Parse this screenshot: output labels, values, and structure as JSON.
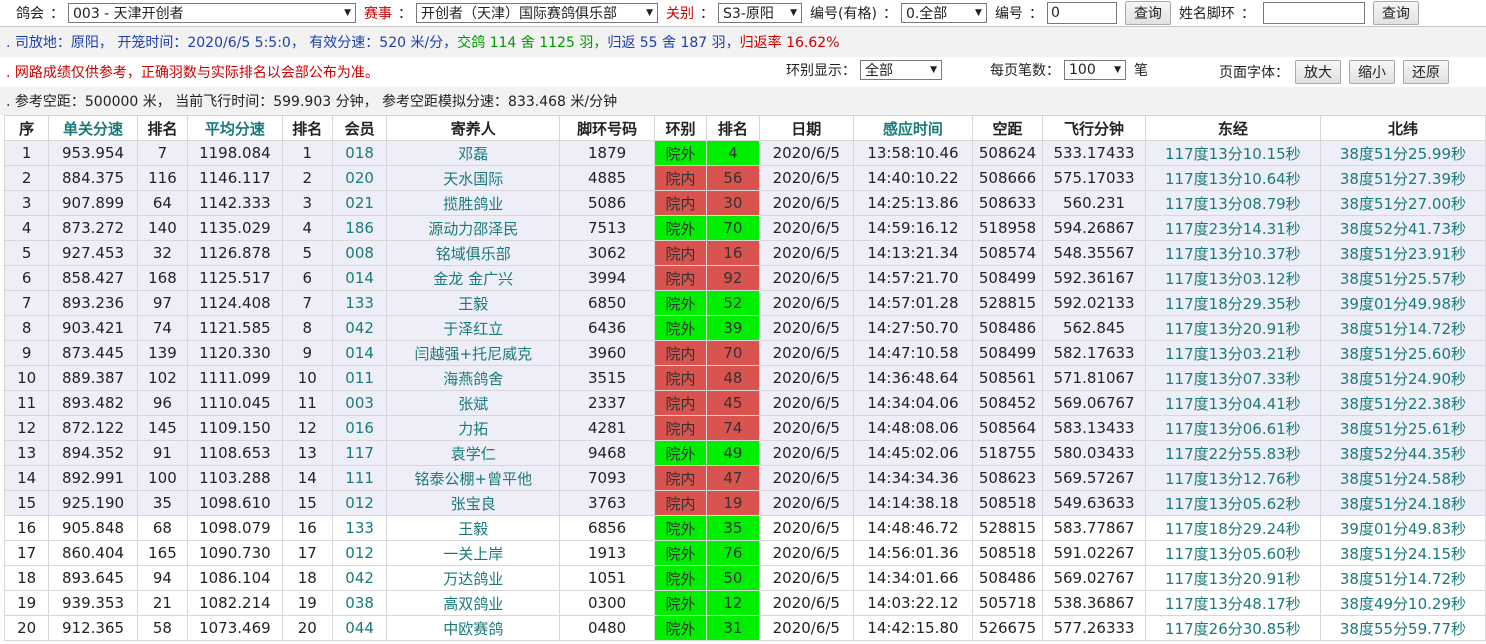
{
  "toolbar": {
    "club_label": "鸽会",
    "club_value": "003 - 天津开创者",
    "race_label": "赛事",
    "race_value": "开创者（天津）国际赛鸽俱乐部",
    "stage_label": "关别",
    "stage_value": "S3-原阳",
    "number_label": "编号(有格)",
    "number_value": "0.全部",
    "code_label": "编号",
    "code_value": "0",
    "query_label": "查询",
    "name_label": "姓名脚环",
    "name_value": "",
    "query2_label": "查询"
  },
  "info": {
    "line1_a": ". 司放地：原阳， 开笼时间：2020/6/5 5:5:0， 有效分速：520 米/分，",
    "line1_b": " 交鸽 114 舍 1125 羽，",
    "line1_c": " 归返 55 舍 187 羽，",
    "line1_d": " 归返率 16.62%",
    "line2": ". 网路成绩仅供参考，正确羽数与实际排名以会部公布为准。",
    "ring_display_label": "环别显示：",
    "ring_display_value": "全部",
    "per_page_label": "每页笔数：",
    "per_page_value": "100",
    "per_page_unit": "笔",
    "font_label": "页面字体：",
    "zoom_in": "放大",
    "zoom_out": "缩小",
    "reset": "还原",
    "line3": ". 参考空距：500000 米， 当前飞行时间：599.903 分钟， 参考空距模拟分速：833.468 米/分钟"
  },
  "table": {
    "headers": [
      "序",
      "单关分速",
      "排名",
      "平均分速",
      "排名",
      "会员",
      "寄养人",
      "脚环号码",
      "环别",
      "排名",
      "日期",
      "感应时间",
      "空距",
      "飞行分钟",
      "东经",
      "北纬"
    ],
    "rows": [
      {
        "seq": "1",
        "speed": "953.954",
        "rank1": "7",
        "avg": "1198.084",
        "rank2": "1",
        "member": "018",
        "owner": "邓磊",
        "ring": "1879",
        "type": "院外",
        "rank3": "4",
        "date": "2020/6/5",
        "time": "13:58:10.46",
        "dist": "508624",
        "mins": "533.17433",
        "lon": "117度13分10.15秒",
        "lat": "38度51分25.99秒"
      },
      {
        "seq": "2",
        "speed": "884.375",
        "rank1": "116",
        "avg": "1146.117",
        "rank2": "2",
        "member": "020",
        "owner": "天水国际",
        "ring": "4885",
        "type": "院内",
        "rank3": "56",
        "date": "2020/6/5",
        "time": "14:40:10.22",
        "dist": "508666",
        "mins": "575.17033",
        "lon": "117度13分10.64秒",
        "lat": "38度51分27.39秒"
      },
      {
        "seq": "3",
        "speed": "907.899",
        "rank1": "64",
        "avg": "1142.333",
        "rank2": "3",
        "member": "021",
        "owner": "揽胜鸽业",
        "ring": "5086",
        "type": "院内",
        "rank3": "30",
        "date": "2020/6/5",
        "time": "14:25:13.86",
        "dist": "508633",
        "mins": "560.231",
        "lon": "117度13分08.79秒",
        "lat": "38度51分27.00秒"
      },
      {
        "seq": "4",
        "speed": "873.272",
        "rank1": "140",
        "avg": "1135.029",
        "rank2": "4",
        "member": "186",
        "owner": "源动力邵泽民",
        "ring": "7513",
        "type": "院外",
        "rank3": "70",
        "date": "2020/6/5",
        "time": "14:59:16.12",
        "dist": "518958",
        "mins": "594.26867",
        "lon": "117度23分14.31秒",
        "lat": "38度52分41.73秒"
      },
      {
        "seq": "5",
        "speed": "927.453",
        "rank1": "32",
        "avg": "1126.878",
        "rank2": "5",
        "member": "008",
        "owner": "铭域俱乐部",
        "ring": "3062",
        "type": "院内",
        "rank3": "16",
        "date": "2020/6/5",
        "time": "14:13:21.34",
        "dist": "508574",
        "mins": "548.35567",
        "lon": "117度13分10.37秒",
        "lat": "38度51分23.91秒"
      },
      {
        "seq": "6",
        "speed": "858.427",
        "rank1": "168",
        "avg": "1125.517",
        "rank2": "6",
        "member": "014",
        "owner": "金龙 金广兴",
        "ring": "3994",
        "type": "院内",
        "rank3": "92",
        "date": "2020/6/5",
        "time": "14:57:21.70",
        "dist": "508499",
        "mins": "592.36167",
        "lon": "117度13分03.12秒",
        "lat": "38度51分25.57秒"
      },
      {
        "seq": "7",
        "speed": "893.236",
        "rank1": "97",
        "avg": "1124.408",
        "rank2": "7",
        "member": "133",
        "owner": "王毅",
        "ring": "6850",
        "type": "院外",
        "rank3": "52",
        "date": "2020/6/5",
        "time": "14:57:01.28",
        "dist": "528815",
        "mins": "592.02133",
        "lon": "117度18分29.35秒",
        "lat": "39度01分49.98秒"
      },
      {
        "seq": "8",
        "speed": "903.421",
        "rank1": "74",
        "avg": "1121.585",
        "rank2": "8",
        "member": "042",
        "owner": "于泽红立",
        "ring": "6436",
        "type": "院外",
        "rank3": "39",
        "date": "2020/6/5",
        "time": "14:27:50.70",
        "dist": "508486",
        "mins": "562.845",
        "lon": "117度13分20.91秒",
        "lat": "38度51分14.72秒"
      },
      {
        "seq": "9",
        "speed": "873.445",
        "rank1": "139",
        "avg": "1120.330",
        "rank2": "9",
        "member": "014",
        "owner": "闫越强+托尼威克",
        "ring": "3960",
        "type": "院内",
        "rank3": "70",
        "date": "2020/6/5",
        "time": "14:47:10.58",
        "dist": "508499",
        "mins": "582.17633",
        "lon": "117度13分03.21秒",
        "lat": "38度51分25.60秒"
      },
      {
        "seq": "10",
        "speed": "889.387",
        "rank1": "102",
        "avg": "1111.099",
        "rank2": "10",
        "member": "011",
        "owner": "海燕鸽舍",
        "ring": "3515",
        "type": "院内",
        "rank3": "48",
        "date": "2020/6/5",
        "time": "14:36:48.64",
        "dist": "508561",
        "mins": "571.81067",
        "lon": "117度13分07.33秒",
        "lat": "38度51分24.90秒"
      },
      {
        "seq": "11",
        "speed": "893.482",
        "rank1": "96",
        "avg": "1110.045",
        "rank2": "11",
        "member": "003",
        "owner": "张斌",
        "ring": "2337",
        "type": "院内",
        "rank3": "45",
        "date": "2020/6/5",
        "time": "14:34:04.06",
        "dist": "508452",
        "mins": "569.06767",
        "lon": "117度13分04.41秒",
        "lat": "38度51分22.38秒"
      },
      {
        "seq": "12",
        "speed": "872.122",
        "rank1": "145",
        "avg": "1109.150",
        "rank2": "12",
        "member": "016",
        "owner": "力拓",
        "ring": "4281",
        "type": "院内",
        "rank3": "74",
        "date": "2020/6/5",
        "time": "14:48:08.06",
        "dist": "508564",
        "mins": "583.13433",
        "lon": "117度13分06.61秒",
        "lat": "38度51分25.61秒"
      },
      {
        "seq": "13",
        "speed": "894.352",
        "rank1": "91",
        "avg": "1108.653",
        "rank2": "13",
        "member": "117",
        "owner": "袁学仁",
        "ring": "9468",
        "type": "院外",
        "rank3": "49",
        "date": "2020/6/5",
        "time": "14:45:02.06",
        "dist": "518755",
        "mins": "580.03433",
        "lon": "117度22分55.83秒",
        "lat": "38度52分44.35秒"
      },
      {
        "seq": "14",
        "speed": "892.991",
        "rank1": "100",
        "avg": "1103.288",
        "rank2": "14",
        "member": "111",
        "owner": "铭泰公棚+曾平他",
        "ring": "7093",
        "type": "院内",
        "rank3": "47",
        "date": "2020/6/5",
        "time": "14:34:34.36",
        "dist": "508623",
        "mins": "569.57267",
        "lon": "117度13分12.76秒",
        "lat": "38度51分24.58秒"
      },
      {
        "seq": "15",
        "speed": "925.190",
        "rank1": "35",
        "avg": "1098.610",
        "rank2": "15",
        "member": "012",
        "owner": "张宝良",
        "ring": "3763",
        "type": "院内",
        "rank3": "19",
        "date": "2020/6/5",
        "time": "14:14:38.18",
        "dist": "508518",
        "mins": "549.63633",
        "lon": "117度13分05.62秒",
        "lat": "38度51分24.18秒"
      },
      {
        "seq": "16",
        "speed": "905.848",
        "rank1": "68",
        "avg": "1098.079",
        "rank2": "16",
        "member": "133",
        "owner": "王毅",
        "ring": "6856",
        "type": "院外",
        "rank3": "35",
        "date": "2020/6/5",
        "time": "14:48:46.72",
        "dist": "528815",
        "mins": "583.77867",
        "lon": "117度18分29.24秒",
        "lat": "39度01分49.83秒"
      },
      {
        "seq": "17",
        "speed": "860.404",
        "rank1": "165",
        "avg": "1090.730",
        "rank2": "17",
        "member": "012",
        "owner": "一关上岸",
        "ring": "1913",
        "type": "院外",
        "rank3": "76",
        "date": "2020/6/5",
        "time": "14:56:01.36",
        "dist": "508518",
        "mins": "591.02267",
        "lon": "117度13分05.60秒",
        "lat": "38度51分24.15秒"
      },
      {
        "seq": "18",
        "speed": "893.645",
        "rank1": "94",
        "avg": "1086.104",
        "rank2": "18",
        "member": "042",
        "owner": "万达鸽业",
        "ring": "1051",
        "type": "院外",
        "rank3": "50",
        "date": "2020/6/5",
        "time": "14:34:01.66",
        "dist": "508486",
        "mins": "569.02767",
        "lon": "117度13分20.91秒",
        "lat": "38度51分14.72秒"
      },
      {
        "seq": "19",
        "speed": "939.353",
        "rank1": "21",
        "avg": "1082.214",
        "rank2": "19",
        "member": "038",
        "owner": "高双鸽业",
        "ring": "0300",
        "type": "院外",
        "rank3": "12",
        "date": "2020/6/5",
        "time": "14:03:22.12",
        "dist": "505718",
        "mins": "538.36867",
        "lon": "117度13分48.17秒",
        "lat": "38度49分10.29秒"
      },
      {
        "seq": "20",
        "speed": "912.365",
        "rank1": "58",
        "avg": "1073.469",
        "rank2": "20",
        "member": "044",
        "owner": "中欧赛鸽",
        "ring": "0480",
        "type": "院外",
        "rank3": "31",
        "date": "2020/6/5",
        "time": "14:42:15.80",
        "dist": "526675",
        "mins": "577.26333",
        "lon": "117度26分30.85秒",
        "lat": "38度55分59.77秒"
      }
    ]
  }
}
